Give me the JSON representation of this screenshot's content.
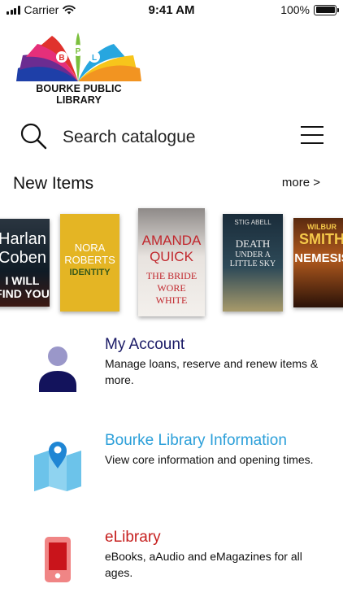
{
  "status_bar": {
    "carrier": "Carrier",
    "time": "9:41 AM",
    "battery": "100%"
  },
  "logo": {
    "letters": [
      "B",
      "P",
      "L"
    ],
    "name": "BOURKE PUBLIC LIBRARY"
  },
  "search": {
    "label": "Search catalogue"
  },
  "new_items": {
    "title": "New Items",
    "more": "more >",
    "books": [
      {
        "line1": "Harlan",
        "line2": "Coben",
        "line3": "I WILL FIND YOU"
      },
      {
        "line1": "NORA",
        "line2": "ROBERTS",
        "line3": "IDENTITY"
      },
      {
        "line1": "AMANDA",
        "line2": "QUICK",
        "line3": "THE BRIDE WORE WHITE"
      },
      {
        "line1": "STIG ABELL",
        "line2": "DEATH",
        "line3": "UNDER A LITTLE SKY"
      },
      {
        "line1": "WILBUR",
        "line2": "SMITH",
        "line3": "NEMESIS"
      }
    ]
  },
  "menu": [
    {
      "title": "My Account",
      "description": "Manage loans, reserve and renew items & more.",
      "color": "#1a1a66"
    },
    {
      "title": "Bourke Library Information",
      "description": "View core information and opening times.",
      "color": "#2b9fd9"
    },
    {
      "title": "eLibrary",
      "description": "eBooks, aAudio and eMagazines for all ages.",
      "color": "#c6201f"
    }
  ]
}
